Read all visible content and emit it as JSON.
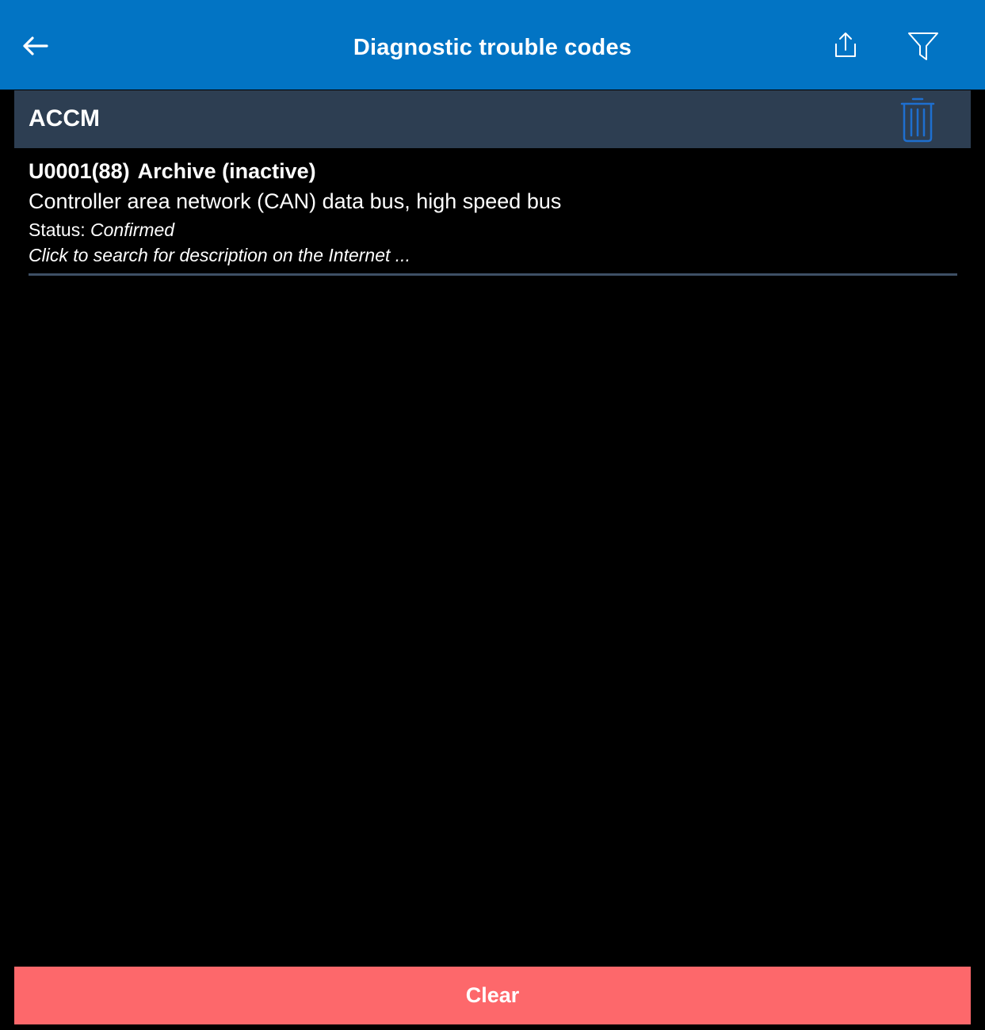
{
  "header": {
    "title": "Diagnostic trouble codes",
    "back_icon": "arrow-left-icon",
    "share_icon": "share-icon",
    "filter_icon": "filter-icon",
    "background_color": "#0274c4"
  },
  "module": {
    "name": "ACCM",
    "delete_icon": "trash-icon",
    "background_color": "#2d3e52"
  },
  "dtcs": [
    {
      "code": "U0001(88)",
      "state": "Archive (inactive)",
      "description": "Controller area network (CAN) data bus, high speed bus",
      "status_label": "Status:",
      "status_value": "Confirmed",
      "search_hint": "Click to search for description on the Internet ..."
    }
  ],
  "footer": {
    "clear_label": "Clear",
    "clear_color": "#fd686b"
  }
}
